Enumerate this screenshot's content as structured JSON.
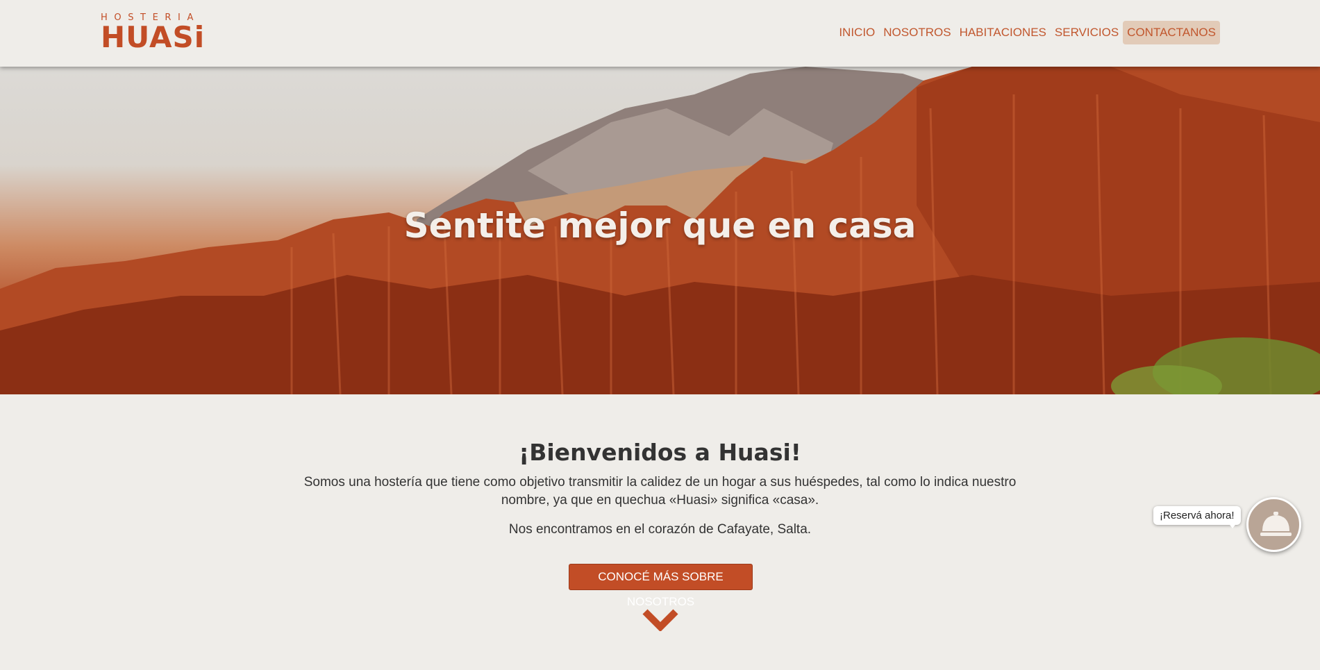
{
  "brand": {
    "top": "HOSTERIA",
    "name": "HUASi"
  },
  "nav": {
    "items": [
      {
        "label": "INICIO"
      },
      {
        "label": "NOSOTROS"
      },
      {
        "label": "HABITACIONES"
      },
      {
        "label": "SERVICIOS"
      },
      {
        "label": "CONTACTANOS"
      }
    ],
    "active": "CONTACTANOS"
  },
  "hero": {
    "title": "Sentite mejor que en casa"
  },
  "welcome": {
    "title": "¡Bienvenidos a Huasi!",
    "paragraph1": "Somos una hostería que tiene como objetivo transmitir la calidez de un hogar a sus huéspedes, tal como lo indica nuestro nombre, ya que en quechua «Huasi» significa «casa».",
    "paragraph2": "Nos encontramos en el corazón de Cafayate, Salta."
  },
  "cta": {
    "label": "CONOCÉ MÁS SOBRE NOSOTROS"
  },
  "reserve": {
    "label": "¡Reservá ahora!"
  },
  "icons": {
    "scroll": "chevron-down-icon",
    "reserve": "service-bell-icon"
  },
  "colors": {
    "brand": "#c24d26",
    "background": "#efede9",
    "nav_active_bg": "#e2cbb8",
    "reserve_button": "#b9a596"
  }
}
